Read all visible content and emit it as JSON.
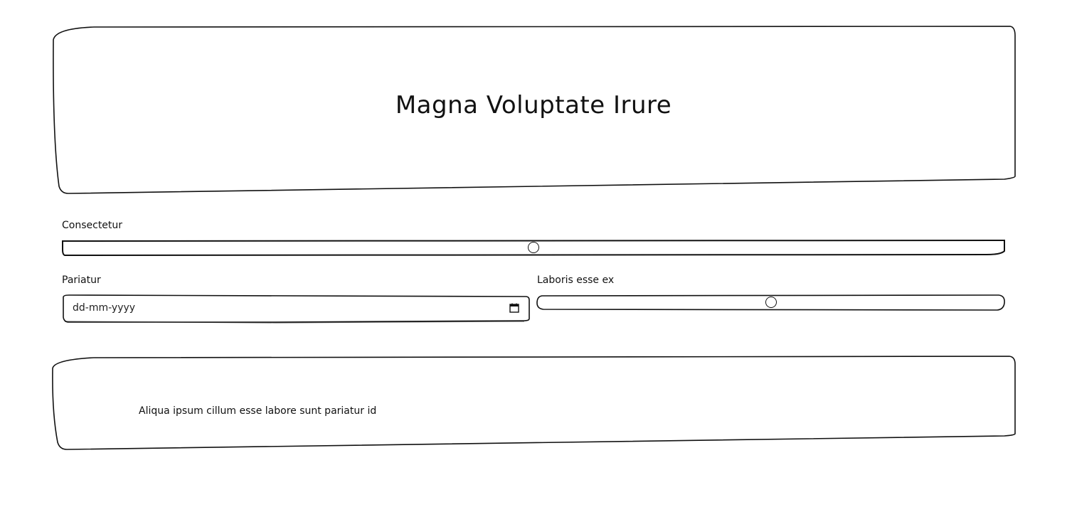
{
  "header": {
    "title": "Magna Voluptate Irure"
  },
  "form": {
    "consectetur": {
      "label": "Consectetur",
      "value_fraction": 0.5
    },
    "pariatur": {
      "label": "Pariatur",
      "placeholder": "dd-mm-yyyy",
      "icon": "calendar-icon"
    },
    "laboris": {
      "label": "Laboris esse ex",
      "value_fraction": 0.5
    }
  },
  "footer": {
    "text": "Aliqua ipsum cillum esse labore sunt pariatur id"
  }
}
